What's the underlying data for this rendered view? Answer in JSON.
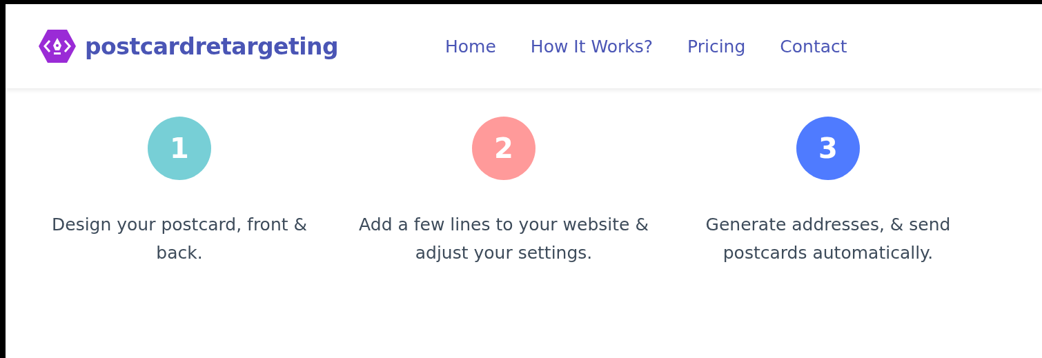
{
  "brand": {
    "name": "postcardretargeting"
  },
  "nav": [
    {
      "label": "Home"
    },
    {
      "label": "How It Works?"
    },
    {
      "label": "Pricing"
    },
    {
      "label": "Contact"
    }
  ],
  "steps": [
    {
      "number": "1",
      "color": "#77cfd6",
      "text": "Design your postcard, front & back."
    },
    {
      "number": "2",
      "color": "#ff9a9a",
      "text": "Add a few lines to your website & adjust your settings."
    },
    {
      "number": "3",
      "color": "#4f7bff",
      "text": "Generate addresses, & send postcards automatically."
    }
  ]
}
